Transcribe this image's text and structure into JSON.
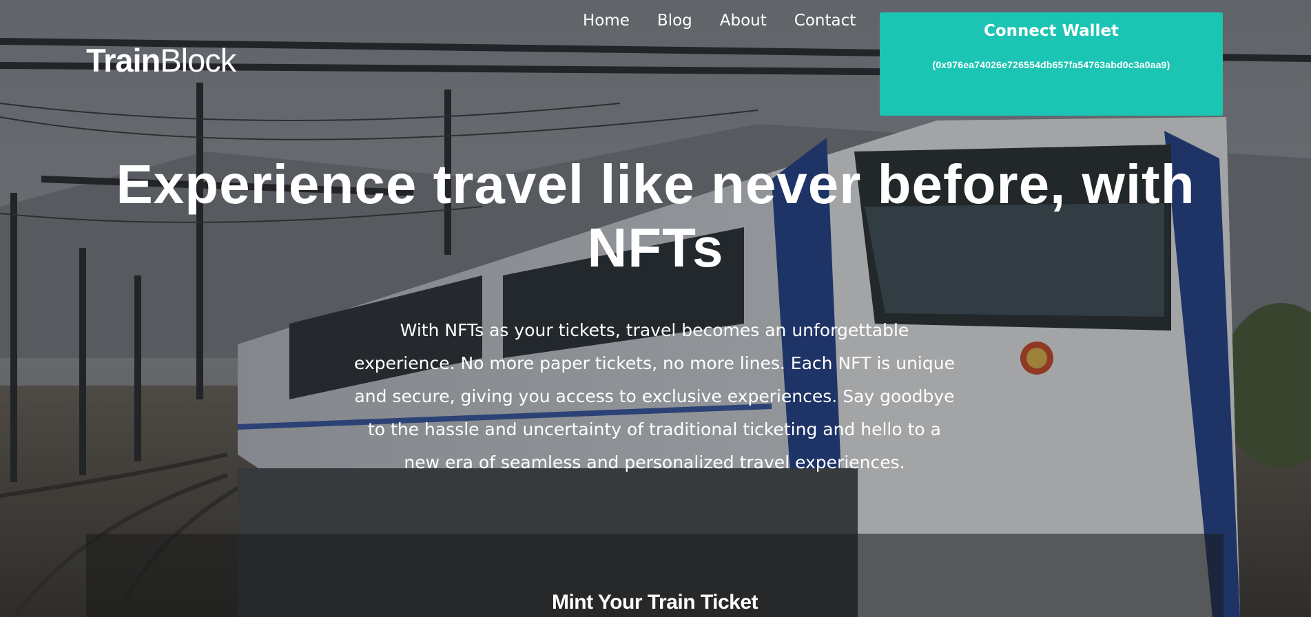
{
  "brand": {
    "name_bold": "Train",
    "name_light": "Block"
  },
  "nav": {
    "items": [
      "Home",
      "Blog",
      "About",
      "Contact"
    ]
  },
  "wallet": {
    "label": "Connect Wallet",
    "address": "(0x976ea74026e726554db657fa54763abd0c3a0aa9)",
    "color": "#1cc4b3"
  },
  "hero": {
    "title": "Experience travel like never before, with NFTs",
    "description": "With NFTs as your tickets, travel becomes an unforgettable experience. No more paper tickets, no more lines. Each NFT is unique and secure, giving you access to exclusive experiences. Say goodbye to the hassle and uncertainty of traditional ticketing and hello to a new era of seamless and personalized travel experiences."
  },
  "mint": {
    "title": "Mint Your Train Ticket"
  }
}
